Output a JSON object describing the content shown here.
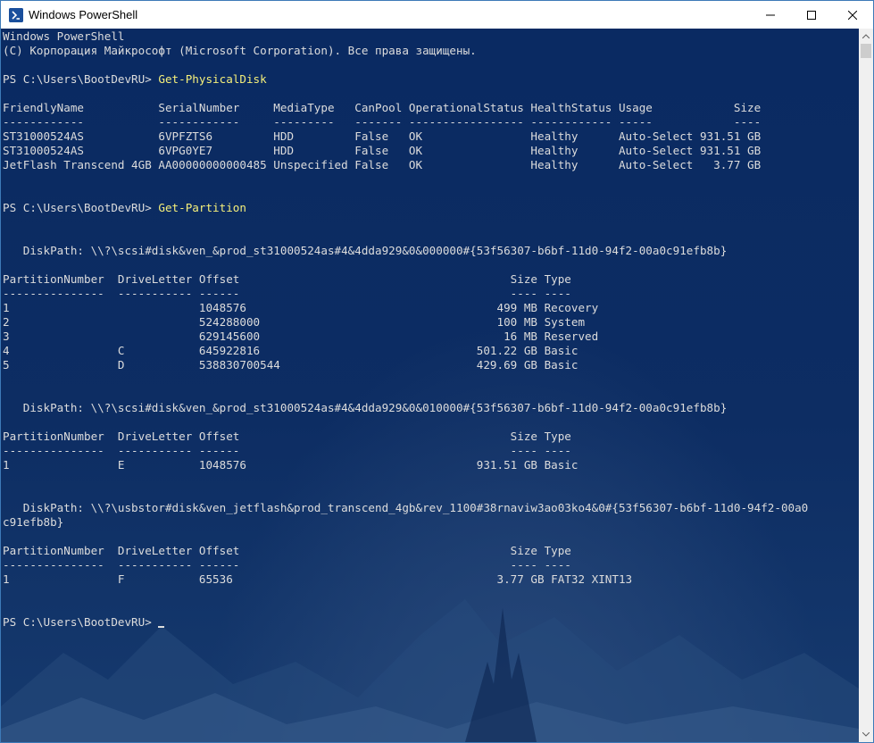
{
  "window": {
    "title": "Windows PowerShell"
  },
  "console": {
    "lines": [
      {
        "text": "Windows PowerShell"
      },
      {
        "text": "(C) Корпорация Майкрософт (Microsoft Corporation). Все права защищены."
      },
      {
        "text": ""
      },
      {
        "text": "PS C:\\Users\\BootDevRU> ",
        "cmd": "Get-PhysicalDisk"
      },
      {
        "text": ""
      },
      {
        "text": "FriendlyName           SerialNumber     MediaType   CanPool OperationalStatus HealthStatus Usage            Size"
      },
      {
        "text": "------------           ------------     ---------   ------- ----------------- ------------ -----            ----"
      },
      {
        "text": "ST31000524AS           6VPFZTS6         HDD         False   OK                Healthy      Auto-Select 931.51 GB"
      },
      {
        "text": "ST31000524AS           6VPG0YE7         HDD         False   OK                Healthy      Auto-Select 931.51 GB"
      },
      {
        "text": "JetFlash Transcend 4GB AA00000000000485 Unspecified False   OK                Healthy      Auto-Select   3.77 GB"
      },
      {
        "text": ""
      },
      {
        "text": ""
      },
      {
        "text": "PS C:\\Users\\BootDevRU> ",
        "cmd": "Get-Partition"
      },
      {
        "text": ""
      },
      {
        "text": ""
      },
      {
        "text": "   DiskPath: \\\\?\\scsi#disk&ven_&prod_st31000524as#4&4dda929&0&000000#{53f56307-b6bf-11d0-94f2-00a0c91efb8b}"
      },
      {
        "text": ""
      },
      {
        "text": "PartitionNumber  DriveLetter Offset                                        Size Type"
      },
      {
        "text": "---------------  ----------- ------                                        ---- ----"
      },
      {
        "text": "1                            1048576                                     499 MB Recovery"
      },
      {
        "text": "2                            524288000                                   100 MB System"
      },
      {
        "text": "3                            629145600                                    16 MB Reserved"
      },
      {
        "text": "4                C           645922816                                501.22 GB Basic"
      },
      {
        "text": "5                D           538830700544                             429.69 GB Basic"
      },
      {
        "text": ""
      },
      {
        "text": ""
      },
      {
        "text": "   DiskPath: \\\\?\\scsi#disk&ven_&prod_st31000524as#4&4dda929&0&010000#{53f56307-b6bf-11d0-94f2-00a0c91efb8b}"
      },
      {
        "text": ""
      },
      {
        "text": "PartitionNumber  DriveLetter Offset                                        Size Type"
      },
      {
        "text": "---------------  ----------- ------                                        ---- ----"
      },
      {
        "text": "1                E           1048576                                  931.51 GB Basic"
      },
      {
        "text": ""
      },
      {
        "text": ""
      },
      {
        "text": "   DiskPath: \\\\?\\usbstor#disk&ven_jetflash&prod_transcend_4gb&rev_1100#38rnaviw3ao03ko4&0#{53f56307-b6bf-11d0-94f2-00a0"
      },
      {
        "text": "c91efb8b}"
      },
      {
        "text": ""
      },
      {
        "text": "PartitionNumber  DriveLetter Offset                                        Size Type"
      },
      {
        "text": "---------------  ----------- ------                                        ---- ----"
      },
      {
        "text": "1                F           65536                                       3.77 GB FAT32 XINT13"
      },
      {
        "text": ""
      },
      {
        "text": ""
      },
      {
        "text": "PS C:\\Users\\BootDevRU> ",
        "cursor": true
      }
    ]
  }
}
